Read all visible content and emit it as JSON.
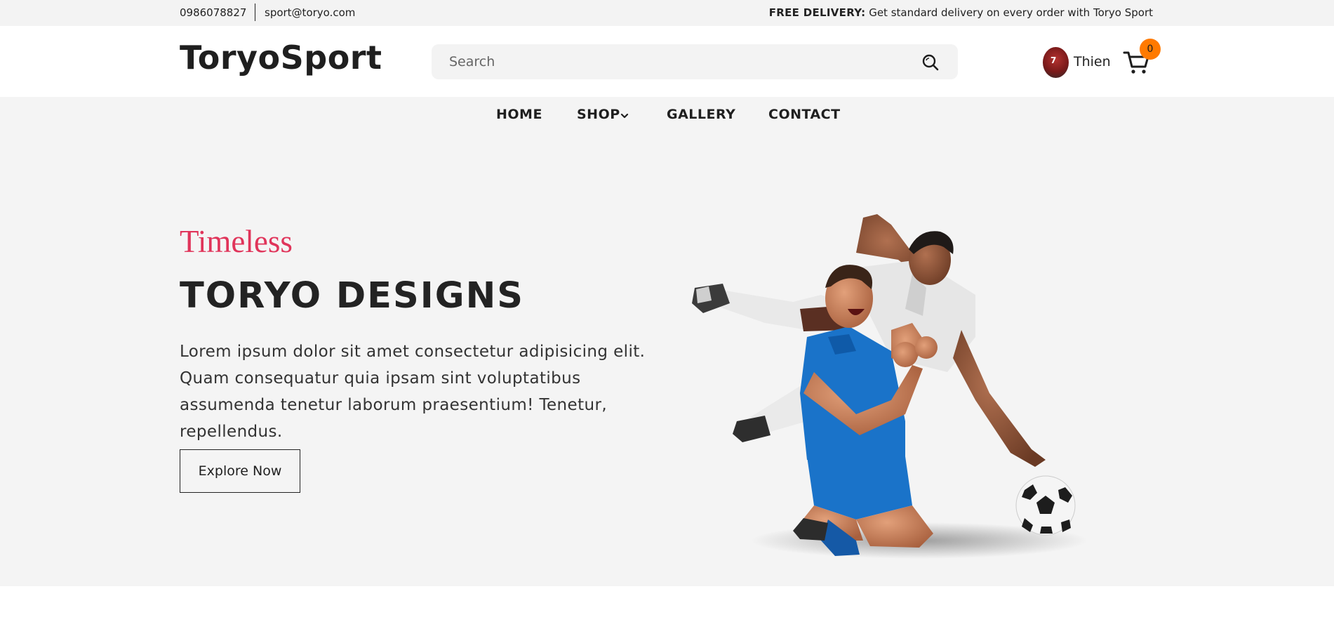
{
  "topbar": {
    "phone": "0986078827",
    "email": "sport@toryo.com",
    "promo_label": "FREE DELIVERY:",
    "promo_text": " Get standard delivery on every order with Toryo Sport"
  },
  "header": {
    "logo": "ToryoSport",
    "search": {
      "placeholder": "Search",
      "value": ""
    },
    "user": {
      "name": "Thien",
      "avatar_badge": "7"
    },
    "cart": {
      "count": "0"
    }
  },
  "nav": {
    "items": [
      {
        "label": "HOME"
      },
      {
        "label": "SHOP"
      },
      {
        "label": "GALLERY"
      },
      {
        "label": "CONTACT"
      }
    ]
  },
  "hero": {
    "tagline": "Timeless",
    "headline": "TORYO DESIGNS",
    "description": "Lorem ipsum dolor sit amet consectetur adipisicing elit. Quam consequatur quia ipsam sint voluptatibus assumenda tenetur laborum praesentium! Tenetur, repellendus.",
    "cta_label": "Explore Now"
  },
  "colors": {
    "accent_pink": "#e0345a",
    "cart_badge": "#ff7a00",
    "topbar_bg": "#f3f3f3",
    "hero_bg": "#f4f4f4",
    "player_blue": "#1a73c9"
  },
  "icons": {
    "search": "search-icon",
    "cart": "cart-icon",
    "shop_dropdown": "chevron-down-icon"
  }
}
